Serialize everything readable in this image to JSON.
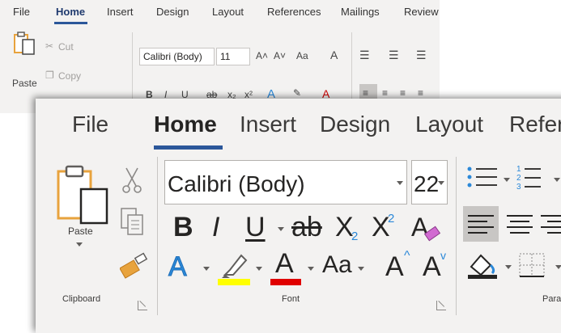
{
  "background_ribbon": {
    "tabs": [
      {
        "label": "File",
        "active": false
      },
      {
        "label": "Home",
        "active": true
      },
      {
        "label": "Insert",
        "active": false
      },
      {
        "label": "Design",
        "active": false
      },
      {
        "label": "Layout",
        "active": false
      },
      {
        "label": "References",
        "active": false
      },
      {
        "label": "Mailings",
        "active": false
      },
      {
        "label": "Review",
        "active": false
      }
    ],
    "paste_label": "Paste",
    "cut_label": "Cut",
    "copy_label": "Copy",
    "font_name": "Calibri (Body)",
    "font_size": "11",
    "change_case": "Aa"
  },
  "foreground_ribbon": {
    "tabs": [
      {
        "label": "File",
        "active": false
      },
      {
        "label": "Home",
        "active": true
      },
      {
        "label": "Insert",
        "active": false
      },
      {
        "label": "Design",
        "active": false
      },
      {
        "label": "Layout",
        "active": false
      },
      {
        "label": "Refer",
        "active": false
      }
    ],
    "clipboard": {
      "paste_label": "Paste",
      "group_label": "Clipboard"
    },
    "font": {
      "font_name": "Calibri (Body)",
      "font_size": "22",
      "bold": "B",
      "italic": "I",
      "underline": "U",
      "strikethrough": "ab",
      "subscript": "X",
      "subscript_mark": "2",
      "superscript": "X",
      "superscript_mark": "2",
      "text_effects": "A",
      "font_color": "A",
      "change_case": "Aa",
      "grow_font": "A",
      "shrink_font": "A",
      "group_label": "Font"
    },
    "paragraph": {
      "group_label": "Para"
    }
  },
  "colors": {
    "ribbon_bg": "#f3f2f1",
    "accent": "#2b579a",
    "highlight_yellow": "#ffff00",
    "font_color_red": "#e00000",
    "icon_blue": "#2b88d8",
    "paste_orange": "#e8a33d"
  }
}
